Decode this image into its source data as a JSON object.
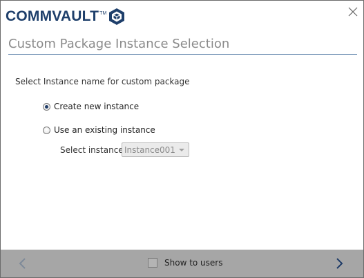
{
  "brand": {
    "name": "COMMVAULT",
    "trademark": "TM"
  },
  "page": {
    "title": "Custom Package Instance Selection"
  },
  "prompt": "Select Instance name for custom package",
  "options": [
    {
      "label": "Create new instance",
      "selected": true
    },
    {
      "label": "Use an existing instance",
      "selected": false
    }
  ],
  "instance_select": {
    "label": "Select instance",
    "value": "Instance001",
    "enabled": false
  },
  "footer": {
    "show_to_users_label": "Show to users",
    "show_to_users_checked": false
  },
  "icons": {
    "close": "close-icon",
    "back": "chevron-left-icon",
    "next": "chevron-right-icon",
    "logo": "commvault-cube-icon"
  },
  "colors": {
    "brand": "#1e3f6b",
    "title": "#8a8a8a",
    "title_rule": "#5a7fa8",
    "footer_bg": "#a6a6a6",
    "next_arrow": "#1f3c68",
    "back_arrow": "#7e8a99"
  }
}
